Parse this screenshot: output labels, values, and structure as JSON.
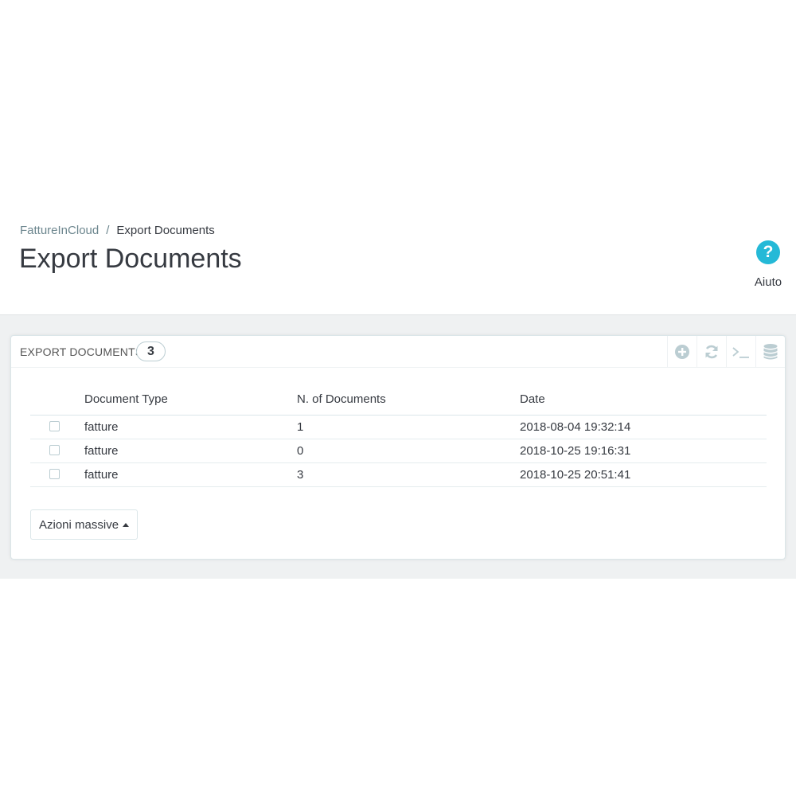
{
  "breadcrumb": {
    "parent": "FattureInCloud",
    "separator": "/",
    "current": "Export Documents"
  },
  "page_title": "Export Documents",
  "help": {
    "label": "Aiuto",
    "icon": "question-circle-icon",
    "glyph": "?"
  },
  "panel": {
    "title": "Export Documents",
    "count": "3",
    "toolbar": [
      {
        "name": "add-new",
        "icon": "plus-circle-icon"
      },
      {
        "name": "refresh-list",
        "icon": "refresh-icon"
      },
      {
        "name": "show-sql",
        "icon": "terminal-icon"
      },
      {
        "name": "export-sql-manager",
        "icon": "database-icon"
      }
    ]
  },
  "table": {
    "columns": [
      "Document Type",
      "N. of Documents",
      "Date"
    ],
    "rows": [
      {
        "type": "fatture",
        "count": "1",
        "date": "2018-08-04 19:32:14"
      },
      {
        "type": "fatture",
        "count": "0",
        "date": "2018-10-25 19:16:31"
      },
      {
        "type": "fatture",
        "count": "3",
        "date": "2018-10-25 20:51:41"
      }
    ]
  },
  "bulk_actions": {
    "label": "Azioni massive",
    "icon": "caret-up-icon"
  },
  "colors": {
    "accent": "#25b9d7",
    "text": "#363a41",
    "muted": "#6c868e",
    "background": "#eff1f2",
    "icon_gray": "#bbcdd2"
  }
}
